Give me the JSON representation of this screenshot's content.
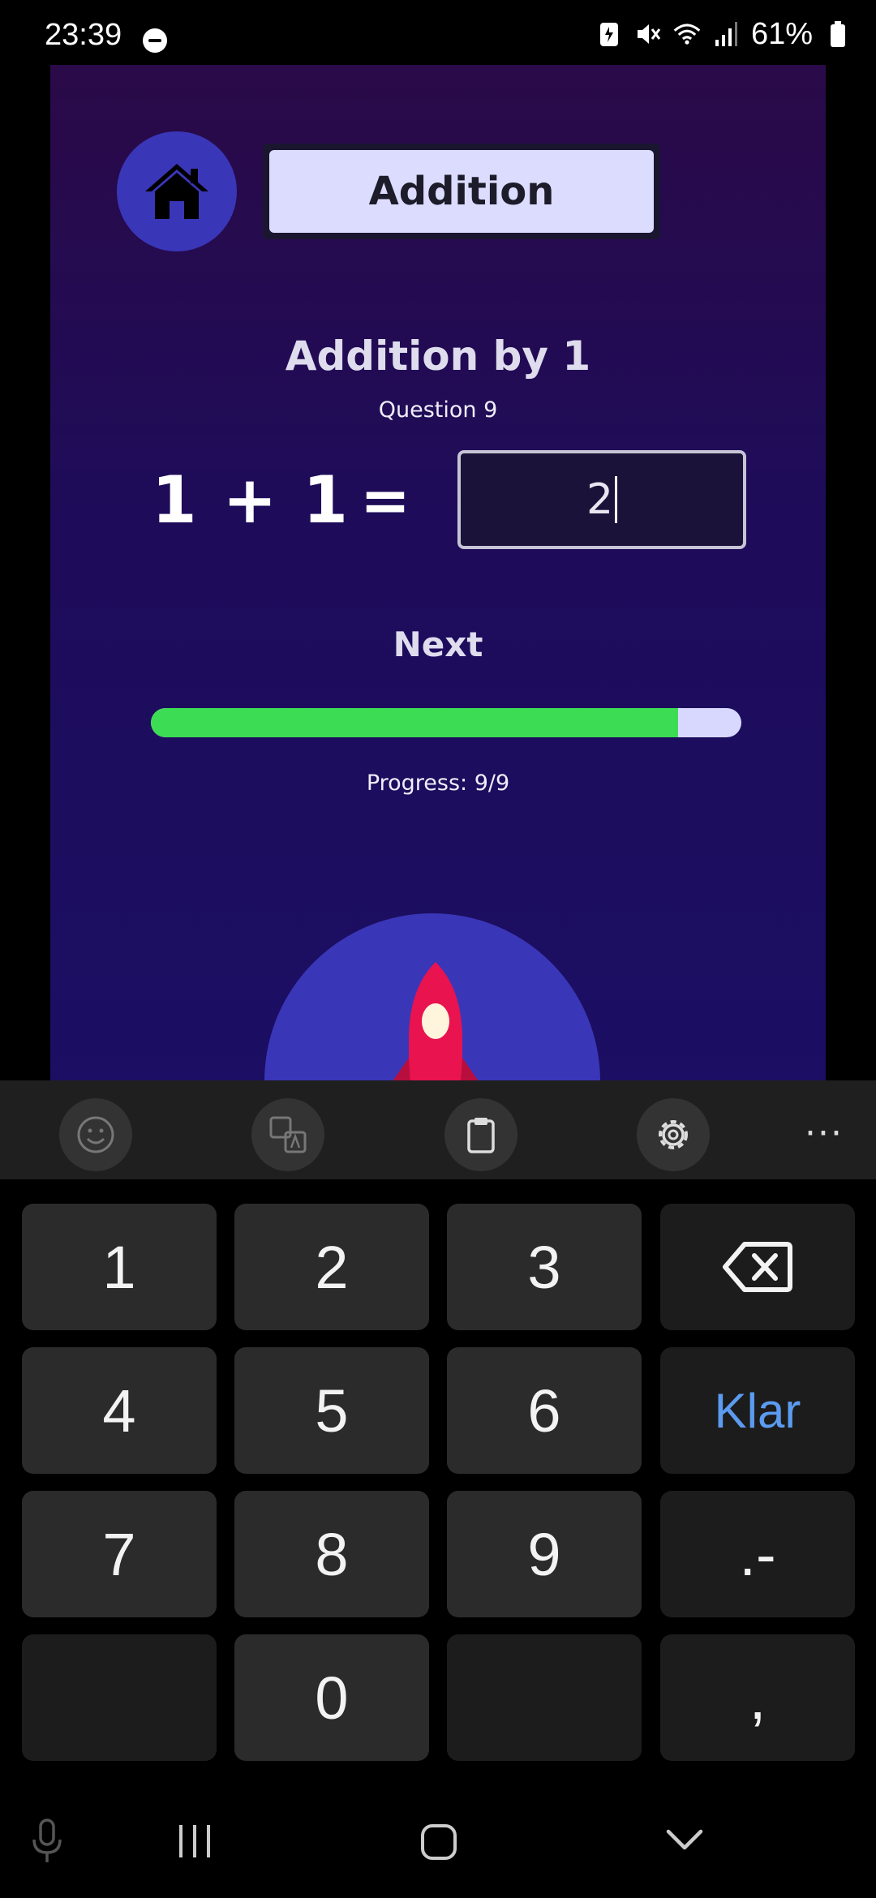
{
  "status_bar": {
    "time": "23:39",
    "battery_pct": "61%",
    "icons": [
      "do-not-disturb-icon",
      "battery-saver-icon",
      "mute-icon",
      "wifi-icon",
      "signal-icon",
      "battery-icon"
    ]
  },
  "game": {
    "home_icon": "home-icon",
    "category_title": "Addition",
    "lesson_title": "Addition by 1",
    "question_label": "Question 9",
    "equation": "1 + 1",
    "equals": "=",
    "answer_value": "2",
    "next_label": "Next",
    "progress": {
      "current": 9,
      "total": 9,
      "fill_fraction": 0.893
    },
    "progress_label": "Progress: 9/9",
    "rocket_icon": "rocket-icon"
  },
  "keyboard_toolbar": {
    "items": [
      "emoji-icon",
      "translate-icon",
      "clipboard-icon",
      "settings-icon",
      "more-icon"
    ],
    "more_label": "···"
  },
  "keyboard": {
    "keys": [
      "1",
      "2",
      "3",
      "⌫",
      "4",
      "5",
      "6",
      "Klar",
      "7",
      "8",
      "9",
      ".-",
      "",
      "0",
      "",
      ","
    ],
    "done_label": "Klar",
    "backspace_icon": "backspace-icon"
  },
  "navbar": {
    "items": [
      "microphone-icon",
      "recent-apps-icon",
      "home-nav-icon",
      "hide-keyboard-icon"
    ]
  },
  "colors": {
    "game_bg_top": "#2a0a48",
    "game_bg_bottom": "#1b0e63",
    "accent_circle": "#3a36b8",
    "progress_green": "#3ddc55",
    "progress_track": "#d8d8ff",
    "rocket_red": "#e8134f",
    "done_blue": "#5b9bf0"
  }
}
